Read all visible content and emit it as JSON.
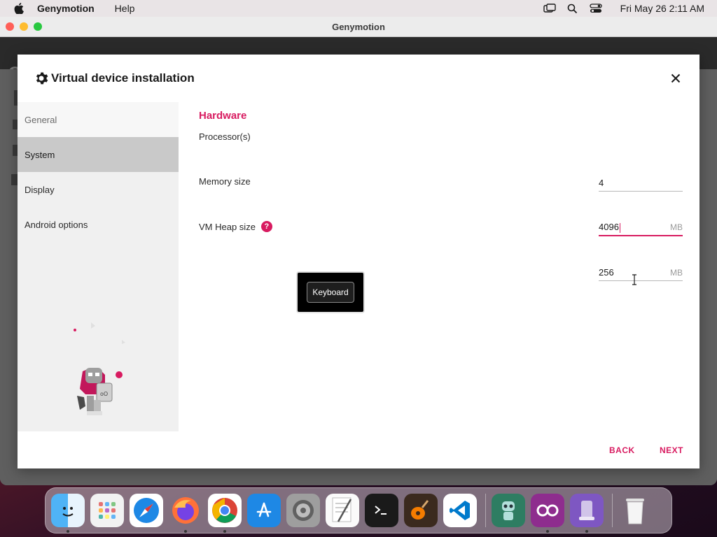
{
  "menubar": {
    "app_name": "Genymotion",
    "menu_help": "Help",
    "clock": "Fri May 26  2:11 AM",
    "icons": [
      "apple-icon",
      "screen-mirroring-icon",
      "search-icon",
      "control-center-icon"
    ]
  },
  "window": {
    "title": "Genymotion"
  },
  "dialog": {
    "title": "Virtual device installation",
    "title_icon": "gear-icon",
    "close_icon": "close-icon",
    "sidebar": {
      "items": [
        {
          "label": "General",
          "state": "normal"
        },
        {
          "label": "System",
          "state": "selected"
        },
        {
          "label": "Display",
          "state": "normal"
        },
        {
          "label": "Android options",
          "state": "normal"
        }
      ]
    },
    "section_title": "Hardware",
    "fields": {
      "processors": {
        "label": "Processor(s)",
        "value": "4",
        "unit": ""
      },
      "memory": {
        "label": "Memory size",
        "value": "4096",
        "unit": "MB",
        "focused": true
      },
      "heap": {
        "label": "VM Heap size",
        "value": "256",
        "unit": "MB",
        "help_icon": "?"
      }
    },
    "keyboard_popup": {
      "label": "Keyboard"
    },
    "buttons": {
      "back": "BACK",
      "next": "NEXT"
    }
  },
  "dock": {
    "apps": [
      "Finder",
      "Launchpad",
      "Safari",
      "Firefox",
      "Chrome",
      "App Store",
      "System Preferences",
      "TextEdit",
      "Terminal",
      "GarageBand",
      "Visual Studio Code",
      "Genymotion Shell",
      "Genymotion",
      "Simulator",
      "Trash"
    ]
  },
  "colors": {
    "accent": "#d81b60",
    "selected_sidebar": "#c9c9c9",
    "sidebar_bg": "#f0f0f0"
  }
}
